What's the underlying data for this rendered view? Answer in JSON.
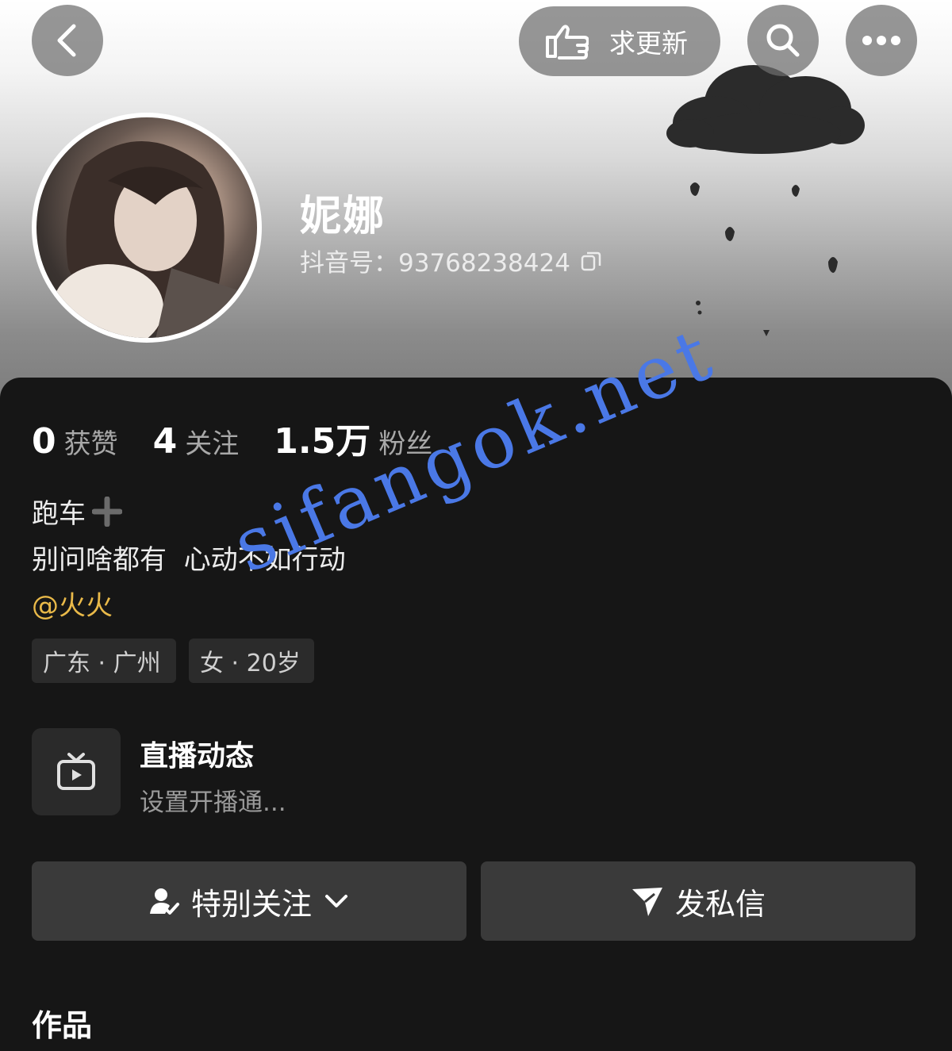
{
  "header": {
    "request_update_label": "求更新"
  },
  "profile": {
    "nickname": "妮娜",
    "douyin_id": "抖音号：93768238424"
  },
  "stats": [
    {
      "value": "0",
      "label": "获赞"
    },
    {
      "value": "4",
      "label": "关注"
    },
    {
      "value": "1.5万",
      "label": "粉丝"
    }
  ],
  "bio": {
    "line1": "跑车",
    "line2": "别问啥都有  心动不如行动",
    "mention": "@火火"
  },
  "tags": {
    "location": "广东 · 广州",
    "gender_age": "女 · 20岁"
  },
  "live": {
    "title": "直播动态",
    "subtitle": "设置开播通..."
  },
  "actions": {
    "follow_label": "特别关注",
    "message_label": "发私信"
  },
  "sections": {
    "works_label": "作品"
  },
  "watermark": {
    "text": "sifangok.net"
  },
  "colors": {
    "panel_bg": "#161616",
    "mention": "#e9b949",
    "watermark": "#4a78e6",
    "button_bg": "#3a3a3a"
  }
}
